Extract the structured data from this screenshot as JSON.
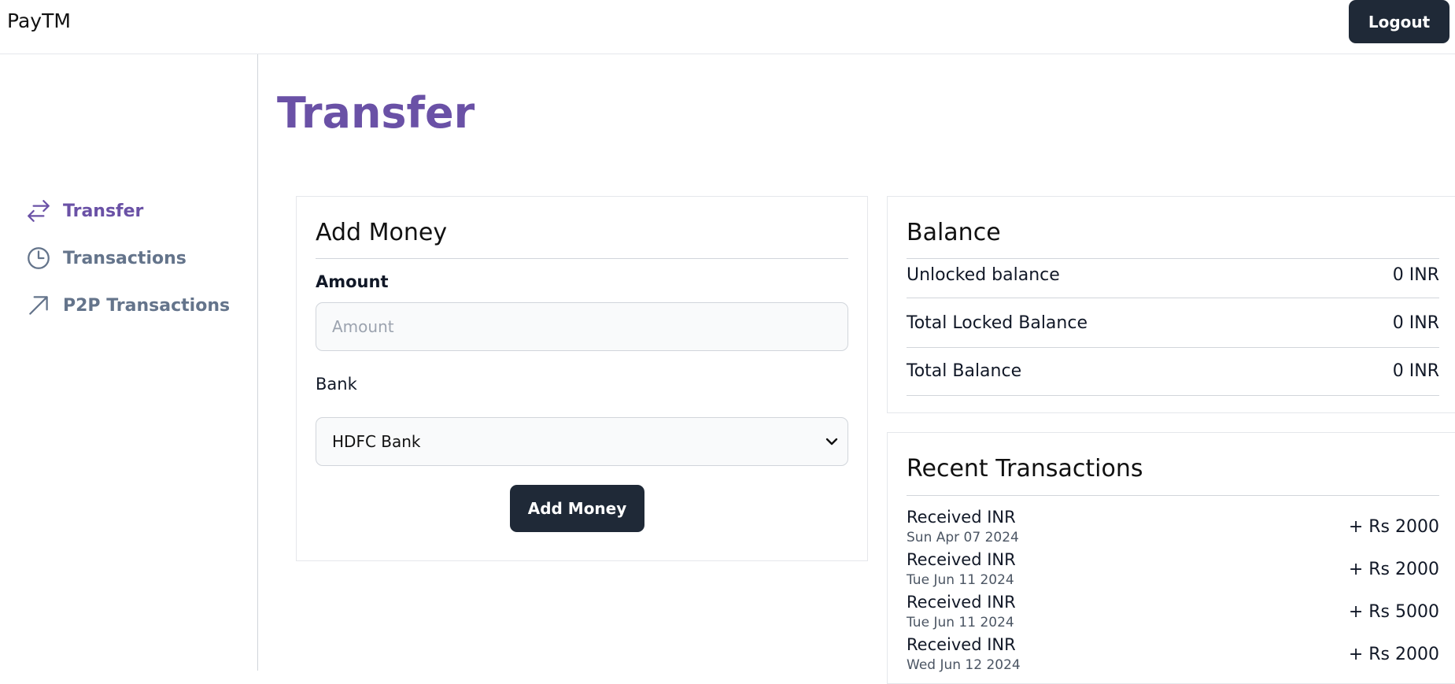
{
  "header": {
    "brand": "PayTM",
    "logout_label": "Logout"
  },
  "sidebar": {
    "items": [
      {
        "label": "Transfer",
        "icon": "transfer-arrows-icon",
        "active": true
      },
      {
        "label": "Transactions",
        "icon": "clock-icon",
        "active": false
      },
      {
        "label": "P2P Transactions",
        "icon": "arrow-up-right-icon",
        "active": false
      }
    ]
  },
  "main": {
    "title": "Transfer"
  },
  "add_money": {
    "title": "Add Money",
    "amount_label": "Amount",
    "amount_placeholder": "Amount",
    "amount_value": "",
    "bank_label": "Bank",
    "bank_selected": "HDFC Bank",
    "submit_label": "Add Money"
  },
  "balance": {
    "title": "Balance",
    "rows": [
      {
        "label": "Unlocked balance",
        "value": "0 INR"
      },
      {
        "label": "Total Locked Balance",
        "value": "0 INR"
      },
      {
        "label": "Total Balance",
        "value": "0 INR"
      }
    ]
  },
  "recent": {
    "title": "Recent Transactions",
    "items": [
      {
        "title": "Received INR",
        "date": "Sun Apr 07 2024",
        "amount": "+ Rs 2000"
      },
      {
        "title": "Received INR",
        "date": "Tue Jun 11 2024",
        "amount": "+ Rs 2000"
      },
      {
        "title": "Received INR",
        "date": "Tue Jun 11 2024",
        "amount": "+ Rs 5000"
      },
      {
        "title": "Received INR",
        "date": "Wed Jun 12 2024",
        "amount": "+ Rs 2000"
      }
    ]
  },
  "colors": {
    "accent": "#6a51a6",
    "dark_button": "#1f2937",
    "muted_nav": "#64748b"
  }
}
